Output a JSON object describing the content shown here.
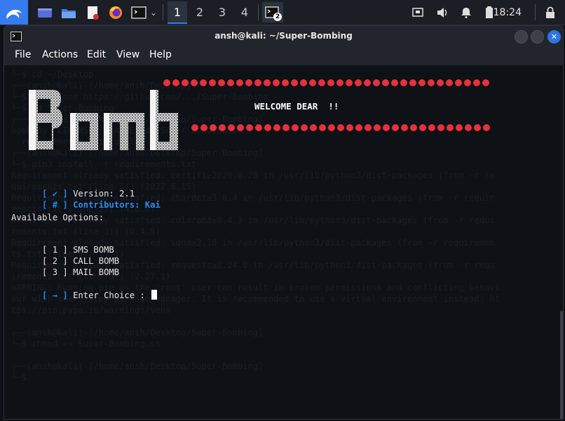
{
  "panel": {
    "workspaces": [
      "1",
      "2",
      "3",
      "4"
    ],
    "taskbar_badge": "2",
    "clock": "18:24"
  },
  "window": {
    "title": "ansh@kali: ~/Super-Bombing",
    "menu": [
      "File",
      "Actions",
      "Edit",
      "View",
      "Help"
    ],
    "close_glyph": "✕"
  },
  "banner": {
    "art_text": "Bomb",
    "welcome": "WELCOME DEAR  !!",
    "dot_color": "#e6323a"
  },
  "terminal": {
    "version_bracket": "[ ✔ ]",
    "version": "Version: 2.1",
    "contrib_bracket": "[ # ]",
    "contributors": "Contributors: Kai",
    "options_header": "Available Options:",
    "options": [
      {
        "num": "[ 1 ]",
        "label": "SMS BOMB"
      },
      {
        "num": "[ 2 ]",
        "label": "CALL BOMB"
      },
      {
        "num": "[ 3 ]",
        "label": "MAIL BOMB"
      }
    ],
    "prompt_bracket": "[ → ]",
    "prompt": "Enter Choice : "
  },
  "ghost_lines": [
    "└─$ cd ~/Desktop",
    "┌──(ansh@kali)-[/home/ansh/Desktop]",
    "└─$ git clone https://github.com/.../Super-Bombing",
    "└─$ cd Super-Bombing",
    "┌──(ansh@kali)-[/home/ansh/Desktop/Super-Bombing]",
    "bomb.py  LICENSE  README.md  Super-Bombing.sh",
    "  requirements.txt  utils",
    "┌──(ansh@kali)-[/home/ansh/Desktop/Super-Bombing]",
    "└─$ pip3 install -r requirements.txt",
    "Requirement already satisfied: certifi≥2020.6.20 in /usr/lib/python3/dist-packages (from -r re",
    "quirements.txt (line 1)) (2022.6.15)",
    "Requirement already satisfied: chardet≥3.0.4 in /usr/lib/python3/dist-packages (from -r requir",
    "ements.txt (line 2)) (4.0.0)",
    "Requirement already satisfied: colorama≥0.4.3 in /usr/lib/python3/dist-packages (from -r requi",
    "rements.txt (line 3)) (0.4.5)",
    "Requirement already satisfied: idna≥2.10 in /usr/lib/python3/dist-packages (from -r requiremen",
    "ts.txt (line 4)) (3.3)",
    "Requirement already satisfied: requests≥2.24.0 in /usr/lib/python3/dist-packages (from -r requ",
    "irements.txt (line 5)) (2.27.1)",
    "WARNING: Running pip as the 'root' user can result in broken permissions and conflicting behavi",
    "our with the system package manager. It is recommended to use a virtual environment instead: ht",
    "tps://pip.pypa.io/warnings/venv",
    "",
    "┌──(ansh@kali)-[/home/ansh/Desktop/Super-Bombing]",
    "└─$ chmod +x Super-Bombing.sh",
    "",
    "┌──(ansh@kali)-[/home/ansh/Desktop/Super-Bombing]",
    "└─$"
  ]
}
